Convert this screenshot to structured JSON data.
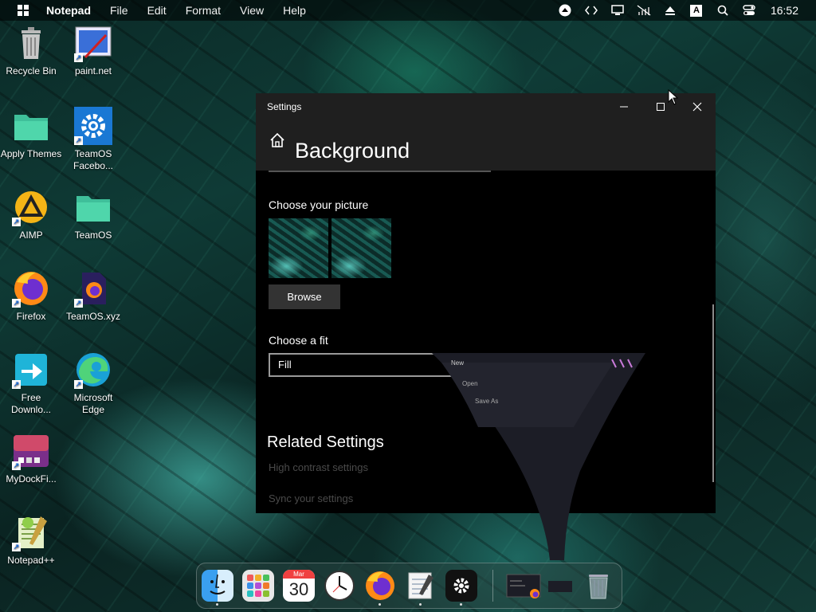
{
  "menubar": {
    "app_name": "Notepad",
    "menus": [
      "File",
      "Edit",
      "Format",
      "View",
      "Help"
    ],
    "tray_text_icon": "A",
    "clock": "16:52"
  },
  "desktop": {
    "icons": [
      {
        "label": "Recycle Bin",
        "icon": "recycle-bin-icon"
      },
      {
        "label": "paint.net",
        "icon": "paint-net-icon"
      },
      {
        "label": "Apply Themes",
        "icon": "folder-icon"
      },
      {
        "label": "TeamOS Facebo...",
        "icon": "gear-icon"
      },
      {
        "label": "AIMP",
        "icon": "aimp-icon"
      },
      {
        "label": "TeamOS",
        "icon": "folder-icon"
      },
      {
        "label": "Firefox",
        "icon": "firefox-icon"
      },
      {
        "label": "TeamOS.xyz",
        "icon": "firefox-file-icon"
      },
      {
        "label": "Free Downlo...",
        "icon": "download-icon"
      },
      {
        "label": "Microsoft Edge",
        "icon": "edge-icon"
      },
      {
        "label": "MyDockFi...",
        "icon": "mydock-icon"
      },
      {
        "label": "Notepad++",
        "icon": "notepad-plus-icon"
      }
    ]
  },
  "settings": {
    "window_title": "Settings",
    "page_title": "Background",
    "choose_picture_label": "Choose your picture",
    "browse_label": "Browse",
    "choose_fit_label": "Choose a fit",
    "fit_value": "Fill",
    "related_title": "Related Settings",
    "related_links": [
      "High contrast settings",
      "Sync your settings"
    ]
  },
  "ghost_menu": {
    "items": [
      "New",
      "Open",
      "Save As"
    ]
  },
  "dock": {
    "calendar_month": "Mar",
    "calendar_day": "30",
    "apps": [
      "finder-icon",
      "launchpad-icon",
      "calendar-icon",
      "clock-icon",
      "firefox-icon",
      "notepad-icon",
      "settings-icon",
      "notepad-window-thumbnail",
      "trash-icon"
    ]
  },
  "colors": {
    "window_bg": "#000000",
    "titlebar_bg": "#1f1f1f",
    "button_bg": "#333333",
    "dim_link": "#4a4a4a"
  }
}
